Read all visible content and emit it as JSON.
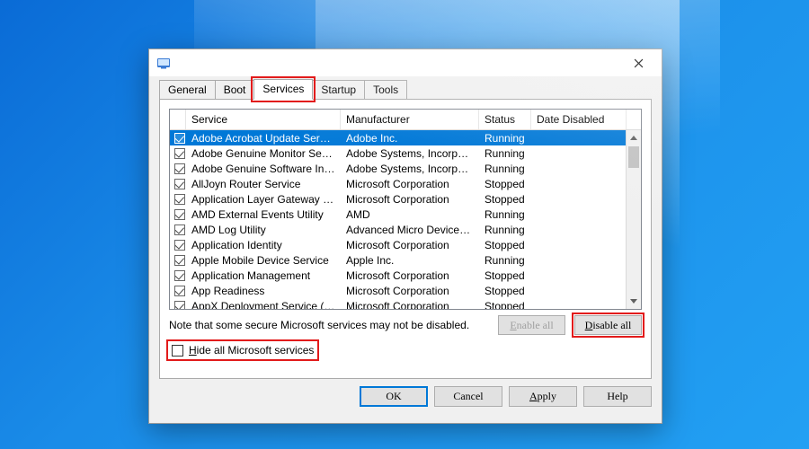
{
  "tabs": {
    "general": "General",
    "boot": "Boot",
    "services": "Services",
    "startup": "Startup",
    "tools": "Tools"
  },
  "columns": {
    "service": "Service",
    "manufacturer": "Manufacturer",
    "status": "Status",
    "date_disabled": "Date Disabled"
  },
  "rows": [
    {
      "name": "Adobe Acrobat Update Service",
      "mfr": "Adobe Inc.",
      "status": "Running",
      "checked": true,
      "selected": true
    },
    {
      "name": "Adobe Genuine Monitor Service",
      "mfr": "Adobe Systems, Incorpora...",
      "status": "Running",
      "checked": true
    },
    {
      "name": "Adobe Genuine Software Integri...",
      "mfr": "Adobe Systems, Incorpora...",
      "status": "Running",
      "checked": true
    },
    {
      "name": "AllJoyn Router Service",
      "mfr": "Microsoft Corporation",
      "status": "Stopped",
      "checked": true
    },
    {
      "name": "Application Layer Gateway Service",
      "mfr": "Microsoft Corporation",
      "status": "Stopped",
      "checked": true
    },
    {
      "name": "AMD External Events Utility",
      "mfr": "AMD",
      "status": "Running",
      "checked": true
    },
    {
      "name": "AMD Log Utility",
      "mfr": "Advanced Micro Devices, I...",
      "status": "Running",
      "checked": true
    },
    {
      "name": "Application Identity",
      "mfr": "Microsoft Corporation",
      "status": "Stopped",
      "checked": true
    },
    {
      "name": "Apple Mobile Device Service",
      "mfr": "Apple Inc.",
      "status": "Running",
      "checked": true
    },
    {
      "name": "Application Management",
      "mfr": "Microsoft Corporation",
      "status": "Stopped",
      "checked": true
    },
    {
      "name": "App Readiness",
      "mfr": "Microsoft Corporation",
      "status": "Stopped",
      "checked": true
    },
    {
      "name": "AppX Deployment Service (AppX...",
      "mfr": "Microsoft Corporation",
      "status": "Stopped",
      "checked": true
    }
  ],
  "note": "Note that some secure Microsoft services may not be disabled.",
  "buttons": {
    "enable_all_prefix": "E",
    "enable_all_rest": "nable all",
    "disable_all_prefix": "D",
    "disable_all_rest": "isable all",
    "ok": "OK",
    "cancel": "Cancel",
    "apply_prefix": "A",
    "apply_rest": "pply",
    "help": "Help"
  },
  "hide_label_prefix": "H",
  "hide_label_rest": "ide all Microsoft services"
}
